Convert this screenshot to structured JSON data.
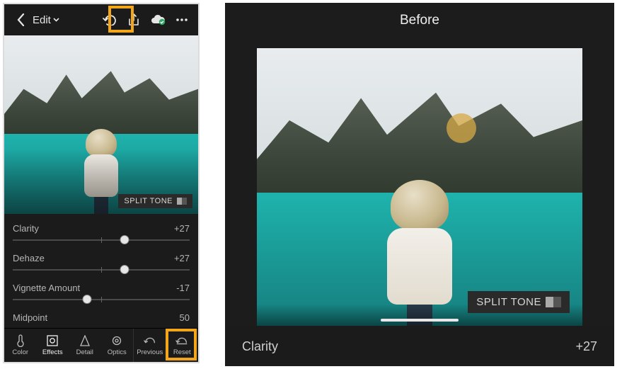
{
  "topbar": {
    "edit_label": "Edit"
  },
  "panel": {
    "split_tone_label": "SPLIT TONE"
  },
  "sliders": [
    {
      "label": "Clarity",
      "value": "+27",
      "pos": 63
    },
    {
      "label": "Dehaze",
      "value": "+27",
      "pos": 63
    },
    {
      "label": "Vignette Amount",
      "value": "-17",
      "pos": 42
    },
    {
      "label": "Midpoint",
      "value": "50",
      "pos": 50
    }
  ],
  "bottombar": {
    "items": [
      "Color",
      "Effects",
      "Detail",
      "Optics",
      "Previous",
      "Reset"
    ],
    "selected_index": 1
  },
  "right": {
    "before_label": "Before",
    "split_tone_label": "SPLIT TONE",
    "slider": {
      "label": "Clarity",
      "value": "+27"
    }
  },
  "highlights": {
    "undo": true,
    "reset": true
  }
}
